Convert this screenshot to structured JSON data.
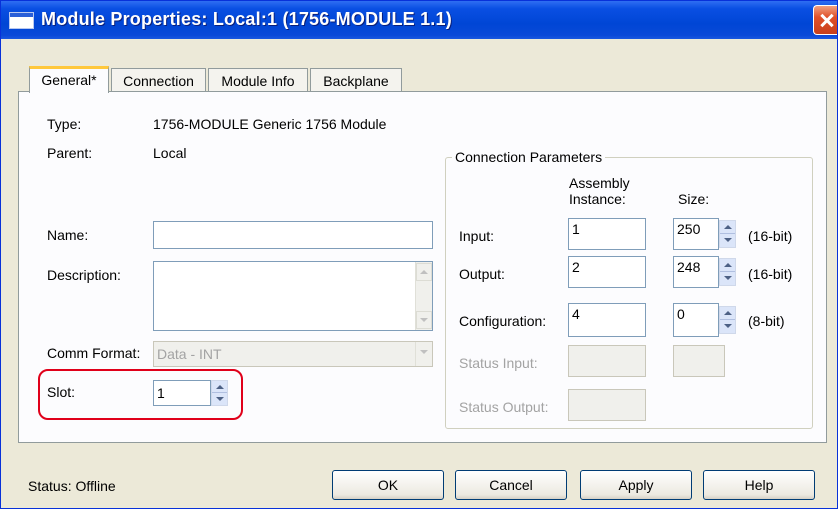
{
  "window": {
    "title": "Module Properties: Local:1 (1756-MODULE 1.1)"
  },
  "tabs": [
    {
      "label": "General*",
      "active": true
    },
    {
      "label": "Connection",
      "active": false
    },
    {
      "label": "Module Info",
      "active": false
    },
    {
      "label": "Backplane",
      "active": false
    }
  ],
  "general": {
    "type_label": "Type:",
    "type_value": "1756-MODULE Generic 1756 Module",
    "parent_label": "Parent:",
    "parent_value": "Local",
    "name_label": "Name:",
    "name_value": "",
    "description_label": "Description:",
    "description_value": "",
    "comm_format_label": "Comm Format:",
    "comm_format_value": "Data - INT",
    "slot_label": "Slot:",
    "slot_value": "1"
  },
  "connection_parameters": {
    "title": "Connection Parameters",
    "col_assembly": "Assembly",
    "col_instance": "Instance:",
    "col_size": "Size:",
    "rows": [
      {
        "label": "Input:",
        "instance": "1",
        "size": "250",
        "unit": "(16-bit)",
        "enabled": true
      },
      {
        "label": "Output:",
        "instance": "2",
        "size": "248",
        "unit": "(16-bit)",
        "enabled": true
      },
      {
        "label": "Configuration:",
        "instance": "4",
        "size": "0",
        "unit": "(8-bit)",
        "enabled": true
      },
      {
        "label": "Status Input:",
        "instance": "",
        "size": "",
        "unit": "",
        "enabled": false
      },
      {
        "label": "Status Output:",
        "instance": "",
        "size": "",
        "unit": "",
        "enabled": false
      }
    ]
  },
  "footer": {
    "status_text": "Status:  Offline",
    "ok_label": "OK",
    "cancel_label": "Cancel",
    "apply_label": "Apply",
    "help_label": "Help"
  },
  "colors": {
    "titlebar": "#0046d5",
    "dialog_bg": "#ece9d8",
    "highlight_circle": "#e0001a"
  }
}
